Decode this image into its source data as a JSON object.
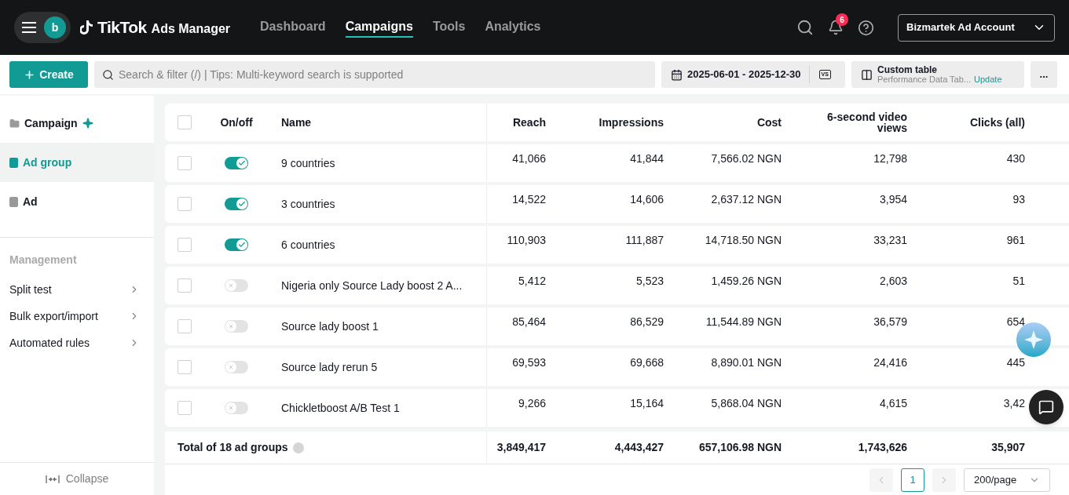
{
  "header": {
    "avatar": "b",
    "logo": "TikTok",
    "product": "Ads Manager",
    "nav": [
      {
        "label": "Dashboard",
        "selected": false
      },
      {
        "label": "Campaigns",
        "selected": true
      },
      {
        "label": "Tools",
        "selected": false
      },
      {
        "label": "Analytics",
        "selected": false
      }
    ],
    "notification_count": "6",
    "account": "Bizmartek Ad Account"
  },
  "toolbar": {
    "create": "Create",
    "search": {
      "placeholder": "Search & filter (/) | Tips: Multi-keyword search is supported"
    },
    "date_range": "2025-06-01 - 2025-12-30",
    "compare": "VS",
    "custom_table": {
      "title": "Custom table",
      "subtitle": "Performance Data Tab...",
      "link": "Update"
    },
    "more": "..."
  },
  "sidebar": {
    "levels": [
      {
        "label": "Campaign",
        "selected": false,
        "sparkle": true
      },
      {
        "label": "Ad group",
        "selected": true,
        "sparkle": false
      },
      {
        "label": "Ad",
        "selected": false,
        "sparkle": false
      }
    ],
    "section": "Management",
    "items": [
      "Split test",
      "Bulk export/import",
      "Automated rules"
    ],
    "collapse": "Collapse"
  },
  "table": {
    "all_checked": false,
    "columns": [
      "On/off",
      "Name",
      "Reach",
      "Impressions",
      "Cost",
      "6-second video views",
      "Clicks (all)"
    ],
    "rows": [
      {
        "on": true,
        "checked": false,
        "name": "9 countries",
        "reach": "41,066",
        "impressions": "41,844",
        "cost": "7,566.02 NGN",
        "views": "12,798",
        "clicks": "430"
      },
      {
        "on": true,
        "checked": false,
        "name": "3 countries",
        "reach": "14,522",
        "impressions": "14,606",
        "cost": "2,637.12 NGN",
        "views": "3,954",
        "clicks": "93"
      },
      {
        "on": true,
        "checked": false,
        "name": "6 countries",
        "reach": "110,903",
        "impressions": "111,887",
        "cost": "14,718.50 NGN",
        "views": "33,231",
        "clicks": "961"
      },
      {
        "on": false,
        "checked": false,
        "name": "Nigeria only Source Lady boost 2 A...",
        "reach": "5,412",
        "impressions": "5,523",
        "cost": "1,459.26 NGN",
        "views": "2,603",
        "clicks": "51"
      },
      {
        "on": false,
        "checked": false,
        "name": "Source lady boost 1",
        "reach": "85,464",
        "impressions": "86,529",
        "cost": "11,544.89 NGN",
        "views": "36,579",
        "clicks": "654"
      },
      {
        "on": false,
        "checked": false,
        "name": "Source lady rerun 5",
        "reach": "69,593",
        "impressions": "69,668",
        "cost": "8,890.01 NGN",
        "views": "24,416",
        "clicks": "445"
      },
      {
        "on": false,
        "checked": false,
        "name": "Chickletboost A/B Test 1",
        "reach": "9,266",
        "impressions": "15,164",
        "cost": "5,868.04 NGN",
        "views": "4,615",
        "clicks": "3,42"
      }
    ],
    "total": {
      "label": "Total of 18 ad groups",
      "reach": "3,849,417",
      "impressions": "4,443,427",
      "cost": "657,106.98 NGN",
      "views": "1,743,626",
      "clicks": "35,907"
    }
  },
  "pagination": {
    "page": "1",
    "page_size": "200/page"
  }
}
